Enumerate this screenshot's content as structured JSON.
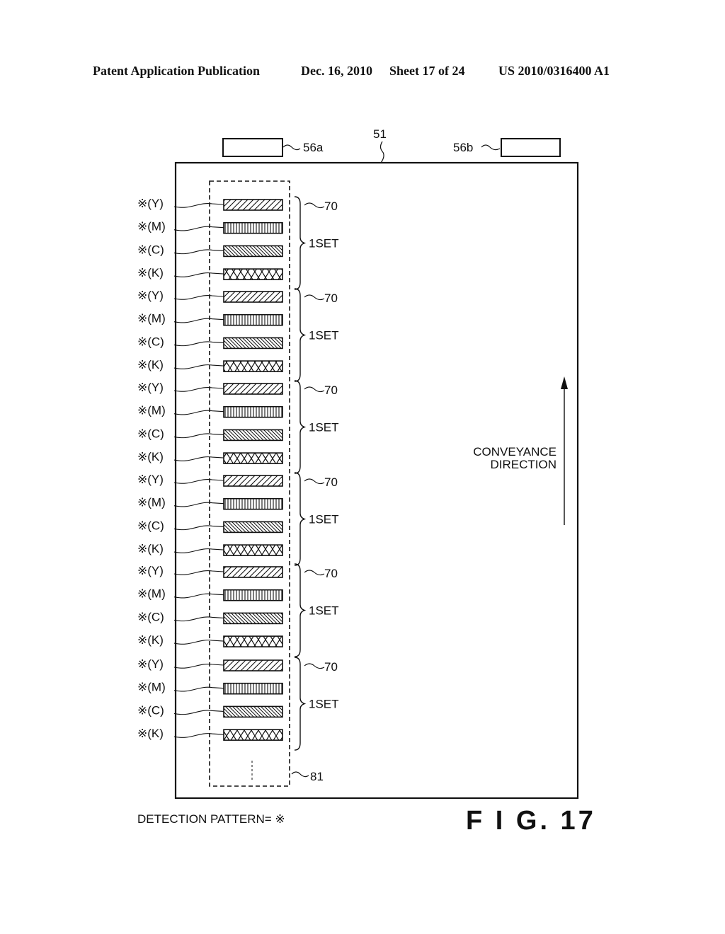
{
  "header": {
    "publication": "Patent Application Publication",
    "date": "Dec. 16, 2010",
    "sheet": "Sheet 17 of 24",
    "number": "US 2010/0316400 A1"
  },
  "figure": {
    "label": "F I G.  17",
    "belt_ref": "51",
    "sensor_left_ref": "56a",
    "sensor_right_ref": "56b",
    "region_ref": "81",
    "set_ref": "70",
    "set_label": "1SET",
    "direction_line1": "CONVEYANCE",
    "direction_line2": "DIRECTION",
    "legend": "DETECTION PATTERN= ※",
    "marker": "※",
    "sets": [
      {
        "patterns": [
          "Y",
          "M",
          "C",
          "K"
        ]
      },
      {
        "patterns": [
          "Y",
          "M",
          "C",
          "K"
        ]
      },
      {
        "patterns": [
          "Y",
          "M",
          "C",
          "K"
        ]
      },
      {
        "patterns": [
          "Y",
          "M",
          "C",
          "K"
        ]
      },
      {
        "patterns": [
          "Y",
          "M",
          "C",
          "K"
        ]
      },
      {
        "patterns": [
          "Y",
          "M",
          "C",
          "K"
        ]
      }
    ],
    "pattern_fills": {
      "Y": "diagonal-forward-hatch",
      "M": "vertical-lines",
      "C": "diagonal-back-hatch",
      "K": "cross-hatch"
    }
  }
}
